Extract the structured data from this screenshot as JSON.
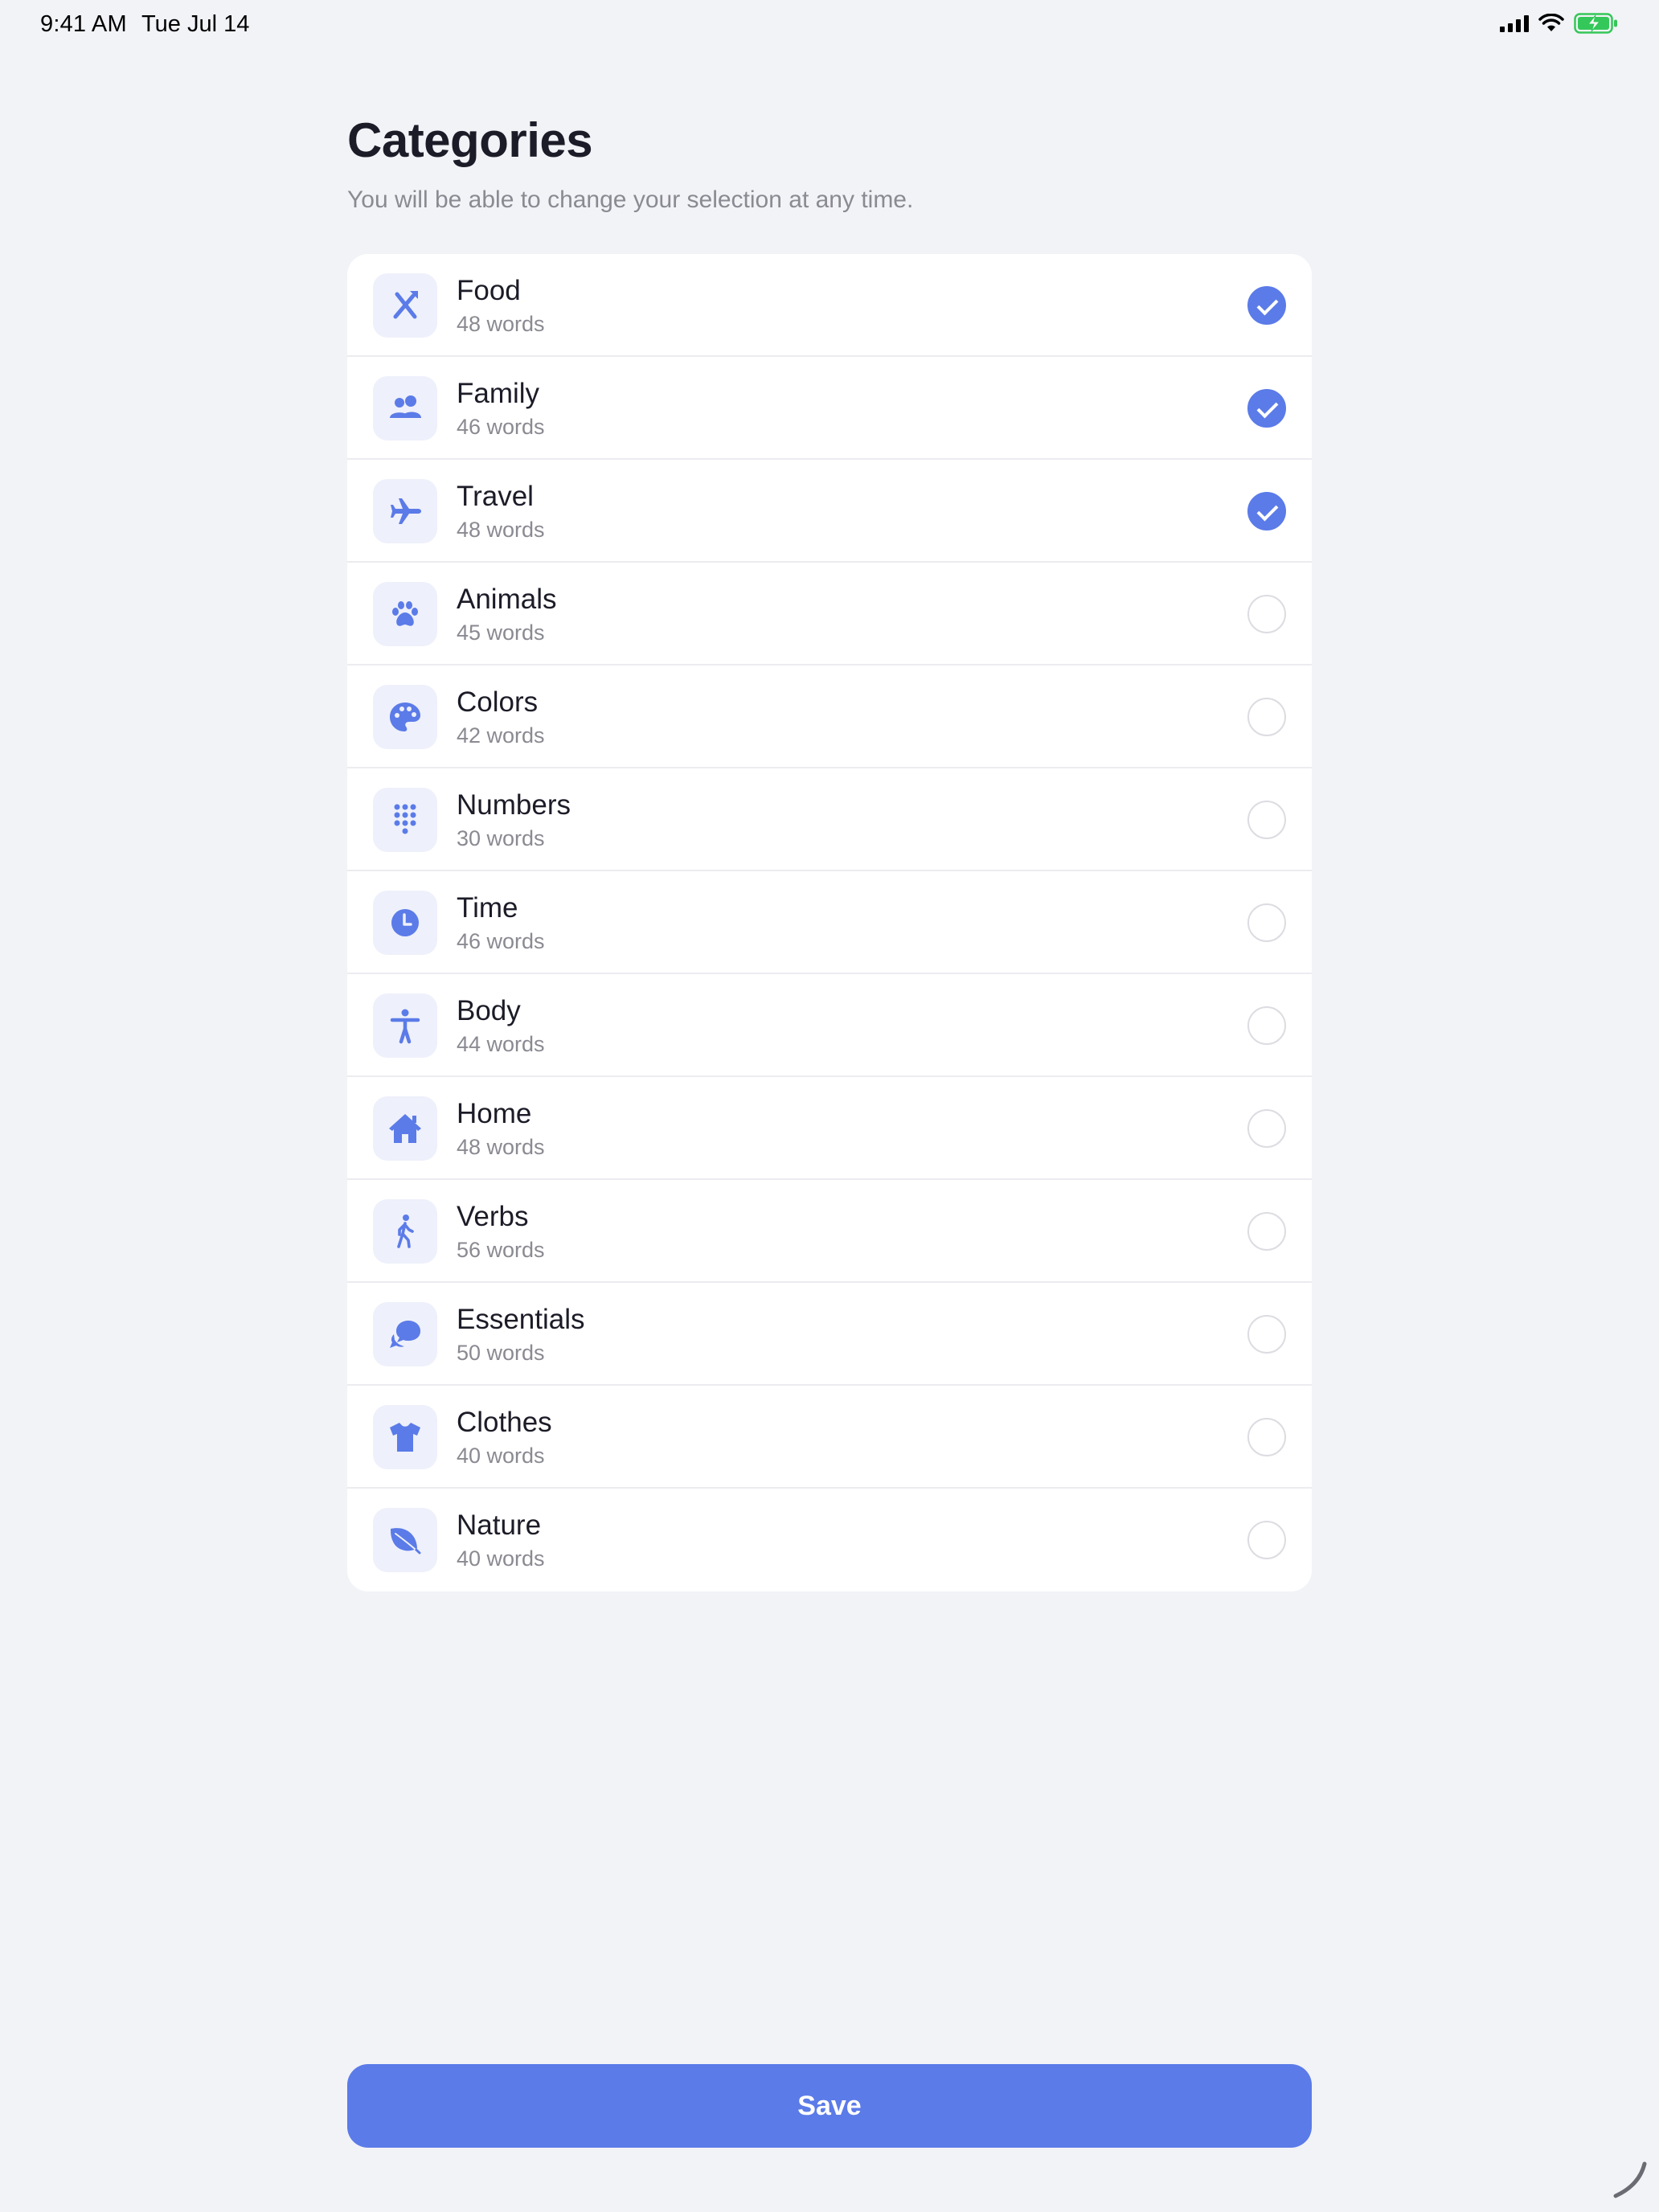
{
  "status_bar": {
    "time": "9:41 AM",
    "date": "Tue Jul 14",
    "battery_color": "#34c759"
  },
  "page": {
    "title": "Categories",
    "subtitle": "You will be able to change your selection at any time."
  },
  "accent_color": "#5b7be8",
  "categories": [
    {
      "name": "Food",
      "count": "48 words",
      "icon": "fork-knife-icon",
      "selected": true
    },
    {
      "name": "Family",
      "count": "46 words",
      "icon": "people-icon",
      "selected": true
    },
    {
      "name": "Travel",
      "count": "48 words",
      "icon": "airplane-icon",
      "selected": true
    },
    {
      "name": "Animals",
      "count": "45 words",
      "icon": "paw-icon",
      "selected": false
    },
    {
      "name": "Colors",
      "count": "42 words",
      "icon": "palette-icon",
      "selected": false
    },
    {
      "name": "Numbers",
      "count": "30 words",
      "icon": "keypad-icon",
      "selected": false
    },
    {
      "name": "Time",
      "count": "46 words",
      "icon": "clock-icon",
      "selected": false
    },
    {
      "name": "Body",
      "count": "44 words",
      "icon": "figure-icon",
      "selected": false
    },
    {
      "name": "Home",
      "count": "48 words",
      "icon": "house-icon",
      "selected": false
    },
    {
      "name": "Verbs",
      "count": "56 words",
      "icon": "walking-icon",
      "selected": false
    },
    {
      "name": "Essentials",
      "count": "50 words",
      "icon": "chat-bubbles-icon",
      "selected": false
    },
    {
      "name": "Clothes",
      "count": "40 words",
      "icon": "tshirt-icon",
      "selected": false
    },
    {
      "name": "Nature",
      "count": "40 words",
      "icon": "leaf-icon",
      "selected": false
    }
  ],
  "save_button": {
    "label": "Save"
  }
}
